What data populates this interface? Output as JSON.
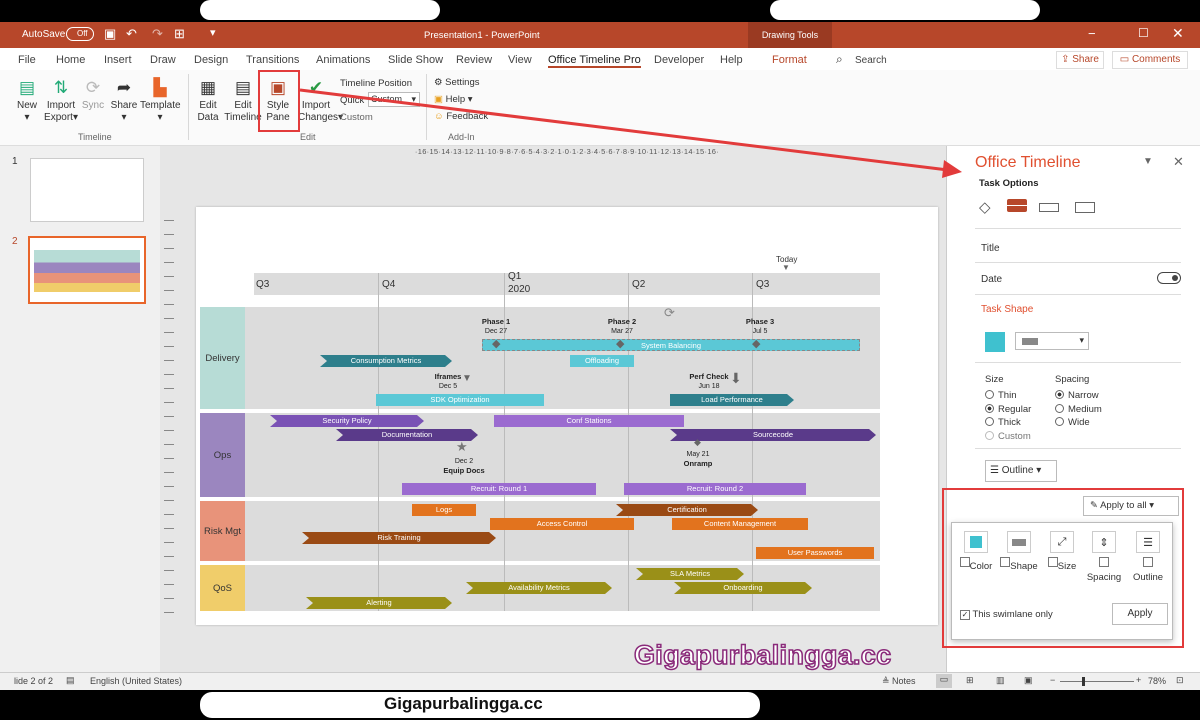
{
  "window": {
    "autosave_label": "AutoSave",
    "autosave_state": "Off",
    "doc_title": "Presentation1 - PowerPoint",
    "context_tab": "Drawing Tools"
  },
  "tabs": [
    "File",
    "Home",
    "Insert",
    "Draw",
    "Design",
    "Transitions",
    "Animations",
    "Slide Show",
    "Review",
    "View",
    "Office Timeline Pro",
    "Developer",
    "Help",
    "Format"
  ],
  "search_label": "Search",
  "share_label": "Share",
  "comments_label": "Comments",
  "ribbon": {
    "new": "New",
    "import": "Import",
    "export": "Export",
    "sync": "Sync",
    "share": "Share",
    "template": "Template",
    "timeline_group": "Timeline",
    "edit_data": "Edit",
    "edit_data2": "Data",
    "edit_timeline": "Edit",
    "edit_timeline2": "Timeline",
    "style_pane": "Style",
    "style_pane2": "Pane",
    "import2": "Import",
    "changes": "Changes",
    "edit_group": "Edit",
    "timeline_position": "Timeline Position",
    "quick": "Quick",
    "quick_value": "Custom",
    "custom": "Custom",
    "settings": "Settings",
    "help": "Help",
    "feedback": "Feedback",
    "addin_group": "Add-In"
  },
  "thumbs": [
    "1",
    "2"
  ],
  "ruler_h": "·16·15·14·13·12·11·10·9·8·7·6·5·4·3·2·1·0·1·2·3·4·5·6·7·8·9·10·11·12·13·14·15·16·",
  "timeline": {
    "today": "Today",
    "quarters": [
      "Q3",
      "Q4",
      "Q1",
      "Q2",
      "Q3"
    ],
    "year": "2020",
    "lanes": [
      {
        "name": "Delivery",
        "color": "#b7dcd6"
      },
      {
        "name": "Ops",
        "color": "#9b86bf"
      },
      {
        "name": "Risk Mgt",
        "color": "#e8937a"
      },
      {
        "name": "QoS",
        "color": "#f0cd6a"
      }
    ],
    "phases": [
      {
        "name": "Phase 1",
        "date": "Dec 27"
      },
      {
        "name": "Phase 2",
        "date": "Mar 27"
      },
      {
        "name": "Phase 3",
        "date": "Jul 5"
      }
    ],
    "tasks": {
      "system_balancing": "System Balancing",
      "consumption": "Consumption Metrics",
      "offloading": "Offloading",
      "sdk": "SDK Optimization",
      "load_perf": "Load Performance",
      "security": "Security Policy",
      "documentation": "Documentation",
      "conf": "Conf Stations",
      "sourcecode": "Sourcecode",
      "recruit1": "Recruit: Round 1",
      "recruit2": "Recruit: Round 2",
      "logs": "Logs",
      "certification": "Certification",
      "access": "Access Control",
      "content": "Content Management",
      "risk_training": "Risk Training",
      "user_pw": "User Passwords",
      "sla": "SLA Metrics",
      "availability": "Availability Metrics",
      "onboarding": "Onboarding",
      "alerting": "Alerting"
    },
    "milestones": {
      "iframes": "Iframes",
      "iframes_date": "Dec 5",
      "perf": "Perf Check",
      "perf_date": "Jun 18",
      "equip": "Equip Docs",
      "equip_date": "Dec 2",
      "onramp": "Onramp",
      "onramp_date": "May 21"
    }
  },
  "pane": {
    "title": "Office Timeline",
    "section": "Task Options",
    "title_label": "Title",
    "date_label": "Date",
    "task_shape": "Task Shape",
    "size": "Size",
    "sizes": [
      "Thin",
      "Regular",
      "Thick",
      "Custom"
    ],
    "spacing": "Spacing",
    "spacings": [
      "Narrow",
      "Medium",
      "Wide"
    ],
    "outline": "Outline",
    "apply_to_all": "Apply to all",
    "accent": "#3fc1cf"
  },
  "popup": {
    "items": [
      "Color",
      "Shape",
      "Size",
      "Spacing",
      "Outline"
    ],
    "swimlane_only": "This swimlane only",
    "apply": "Apply"
  },
  "status": {
    "slide": "lide 2 of 2",
    "language": "English (United States)",
    "notes": "Notes",
    "zoom": "78%"
  },
  "watermark": "Gigapurbalingga.cc",
  "watermark_bottom": "Gigapurbalingga.cc"
}
